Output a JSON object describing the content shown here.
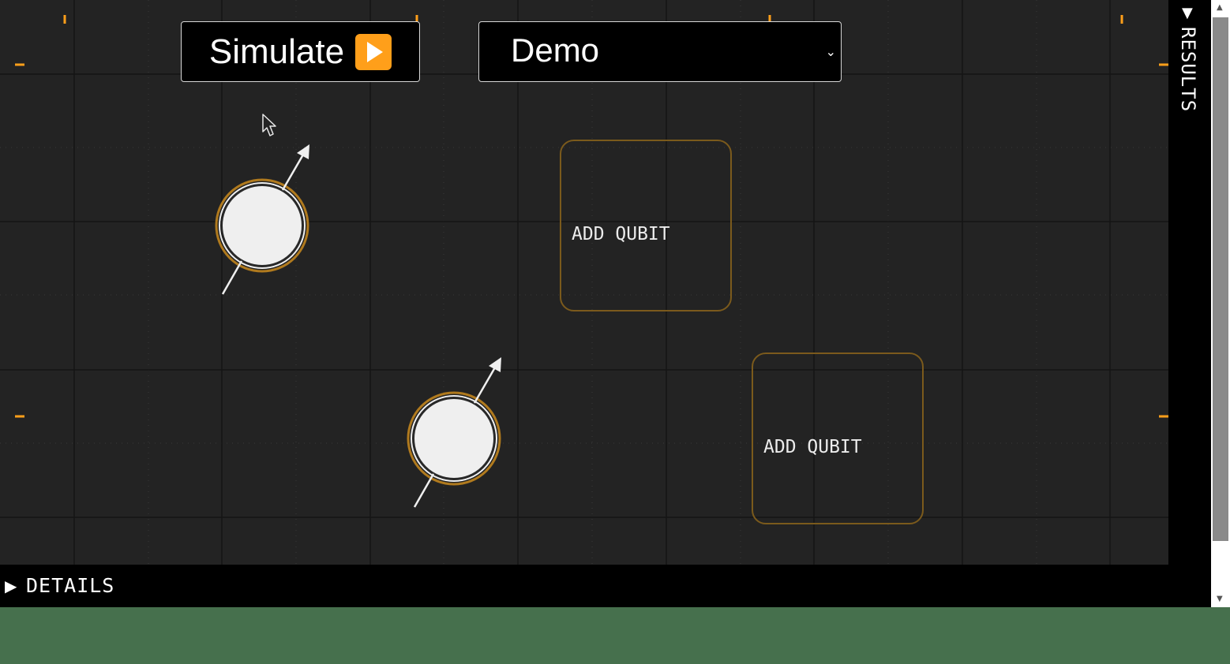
{
  "toolbar": {
    "simulate_label": "Simulate",
    "simulate_icon": "play-icon",
    "demo_value": "Demo",
    "demo_icon": "chevron-down-icon"
  },
  "canvas": {
    "add_qubit_label_1": "ADD QUBIT",
    "add_qubit_label_2": "ADD QUBIT",
    "qubit_icon": "qubit-spin-icon"
  },
  "results_panel": {
    "label": "RESULTS",
    "toggle": "▼"
  },
  "details_panel": {
    "label": "DETAILS",
    "toggle": "▶"
  },
  "colors": {
    "canvas_bg": "#232323",
    "accent": "#ff9f1a",
    "qubit_ring": "#b07a1e",
    "qubit_fill": "#efefef",
    "page_bg": "#46704d"
  }
}
